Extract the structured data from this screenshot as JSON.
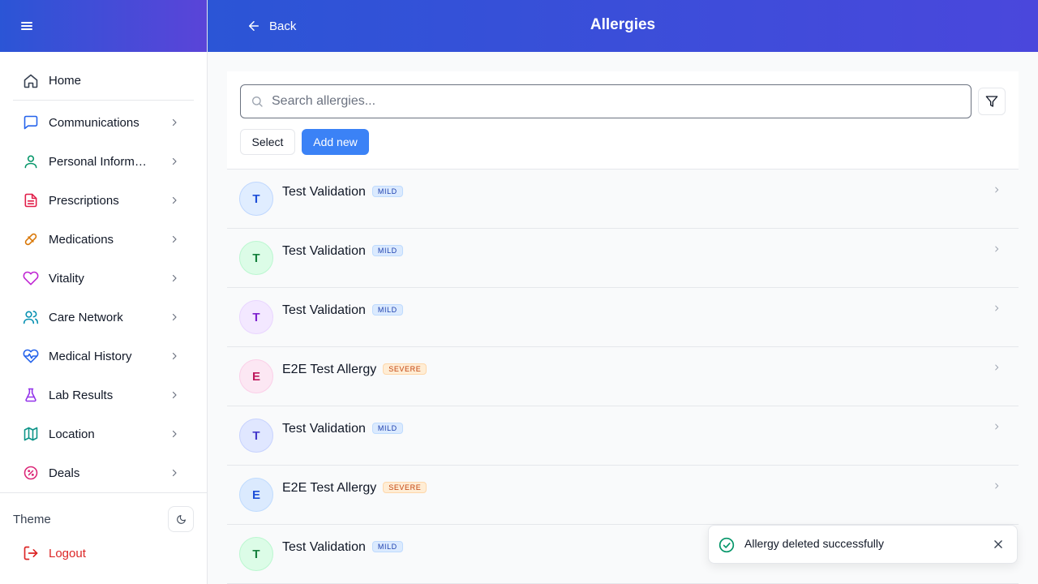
{
  "sidebar": {
    "menu_icon": "hamburger-icon",
    "items": [
      {
        "label": "Home",
        "icon": "home-icon",
        "color": "#374151"
      },
      {
        "label": "Communications",
        "icon": "message-icon",
        "color": "#2563eb"
      },
      {
        "label": "Personal Information",
        "icon": "user-icon",
        "color": "#059669"
      },
      {
        "label": "Prescriptions",
        "icon": "document-icon",
        "color": "#e11d48"
      },
      {
        "label": "Medications",
        "icon": "pill-icon",
        "color": "#d97706"
      },
      {
        "label": "Vitality",
        "icon": "heart-icon",
        "color": "#c026d3"
      },
      {
        "label": "Care Network",
        "icon": "users-icon",
        "color": "#0891b2"
      },
      {
        "label": "Medical History",
        "icon": "heart-pulse-icon",
        "color": "#2563eb"
      },
      {
        "label": "Lab Results",
        "icon": "flask-icon",
        "color": "#9333ea"
      },
      {
        "label": "Location",
        "icon": "map-icon",
        "color": "#0d9488"
      },
      {
        "label": "Deals",
        "icon": "percent-badge-icon",
        "color": "#db2777"
      }
    ],
    "theme_label": "Theme",
    "theme_icon": "moon-icon",
    "logout_label": "Logout",
    "logout_icon": "logout-icon"
  },
  "header": {
    "back_label": "Back",
    "title": "Allergies"
  },
  "toolbar": {
    "search_placeholder": "Search allergies...",
    "select_label": "Select",
    "add_label": "Add new"
  },
  "allergies": [
    {
      "initial": "T",
      "name": "Test Validation",
      "severity": "MILD",
      "level": "mild",
      "avatar_bg": "#e0edff",
      "avatar_fg": "#1d4ed8",
      "avatar_border": "#bfd7fe"
    },
    {
      "initial": "T",
      "name": "Test Validation",
      "severity": "MILD",
      "level": "mild",
      "avatar_bg": "#dcfce7",
      "avatar_fg": "#15803d",
      "avatar_border": "#bbf7d0"
    },
    {
      "initial": "T",
      "name": "Test Validation",
      "severity": "MILD",
      "level": "mild",
      "avatar_bg": "#f3e8ff",
      "avatar_fg": "#7e22ce",
      "avatar_border": "#e9d5ff"
    },
    {
      "initial": "E",
      "name": "E2E Test Allergy",
      "severity": "SEVERE",
      "level": "severe",
      "avatar_bg": "#fce7f3",
      "avatar_fg": "#be185d",
      "avatar_border": "#fbcfe8"
    },
    {
      "initial": "T",
      "name": "Test Validation",
      "severity": "MILD",
      "level": "mild",
      "avatar_bg": "#e0e7ff",
      "avatar_fg": "#4338ca",
      "avatar_border": "#c7d2fe"
    },
    {
      "initial": "E",
      "name": "E2E Test Allergy",
      "severity": "SEVERE",
      "level": "severe",
      "avatar_bg": "#dbeafe",
      "avatar_fg": "#1d4ed8",
      "avatar_border": "#bfdbfe"
    },
    {
      "initial": "T",
      "name": "Test Validation",
      "severity": "MILD",
      "level": "mild",
      "avatar_bg": "#dcfce7",
      "avatar_fg": "#15803d",
      "avatar_border": "#bbf7d0"
    }
  ],
  "toast": {
    "message": "Allergy deleted successfully",
    "icon": "check-circle-icon",
    "close_icon": "close-icon"
  },
  "colors": {
    "header_gradient_start": "#2b55d6",
    "header_gradient_end": "#4a47dc",
    "primary": "#3b82f6",
    "logout": "#dc2626",
    "success": "#059669"
  }
}
